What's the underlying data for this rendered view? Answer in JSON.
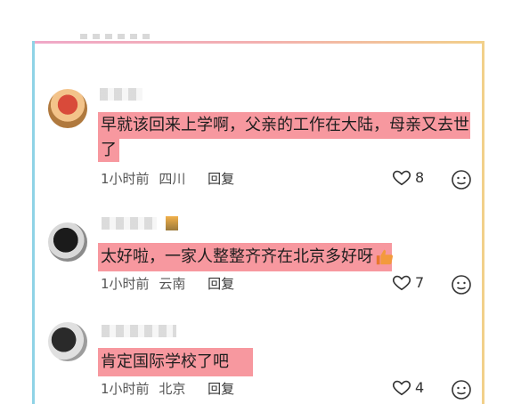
{
  "comments": [
    {
      "text_line1": "早就该回来上学啊，父亲的工作在大陆，母亲又去世",
      "text_line2": "了",
      "time": "1小时前",
      "location": "四川",
      "reply_label": "回复",
      "likes": "8"
    },
    {
      "text": "太好啦，一家人整整齐齐在北京多好呀",
      "time": "1小时前",
      "location": "云南",
      "reply_label": "回复",
      "likes": "7"
    },
    {
      "text": "肯定国际学校了吧",
      "time": "1小时前",
      "location": "北京",
      "reply_label": "回复",
      "likes": "4"
    }
  ],
  "icons": {
    "like": "heart-icon",
    "emoji": "smiley-face-icon",
    "thumbs": "thumbs-up-emoji"
  },
  "colors": {
    "highlight": "#f7929a",
    "border_left": "#8fd3e6",
    "border_right": "#f2d08a"
  }
}
